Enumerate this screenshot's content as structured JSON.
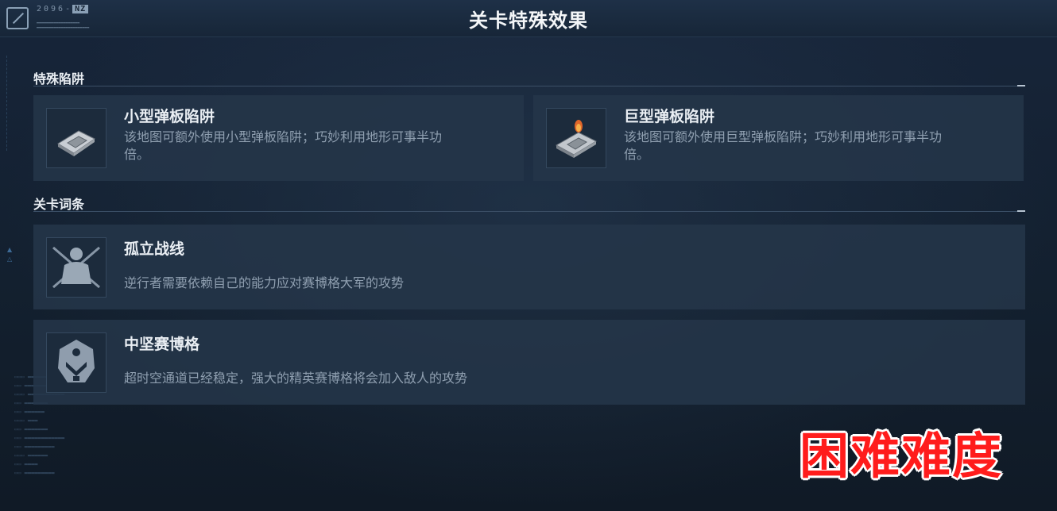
{
  "header": {
    "logo_text": "2096-",
    "logo_badge": "NZ",
    "title": "关卡特殊效果"
  },
  "sections": {
    "traps": {
      "heading": "特殊陷阱",
      "items": [
        {
          "title": "小型弹板陷阱",
          "desc_line1": "该地图可额外使用小型弹板陷阱；巧妙利用地形可事半功",
          "desc_line2": "倍。",
          "icon": "small-spring-trap-icon"
        },
        {
          "title": "巨型弹板陷阱",
          "desc_line1": "该地图可额外使用巨型弹板陷阱；巧妙利用地形可事半功",
          "desc_line2": "倍。",
          "icon": "giant-spring-trap-icon"
        }
      ]
    },
    "modifiers": {
      "heading": "关卡词条",
      "items": [
        {
          "title": "孤立战线",
          "desc": "逆行者需要依赖自己的能力应对赛博格大军的攻势",
          "icon": "isolated-soldier-icon"
        },
        {
          "title": "中坚赛博格",
          "desc": "超时空通道已经稳定，强大的精英赛博格将会加入敌人的攻势",
          "icon": "cyborg-mask-icon"
        }
      ]
    }
  },
  "overlay": {
    "difficulty_label": "困难难度",
    "color": "#ff1c1c"
  }
}
